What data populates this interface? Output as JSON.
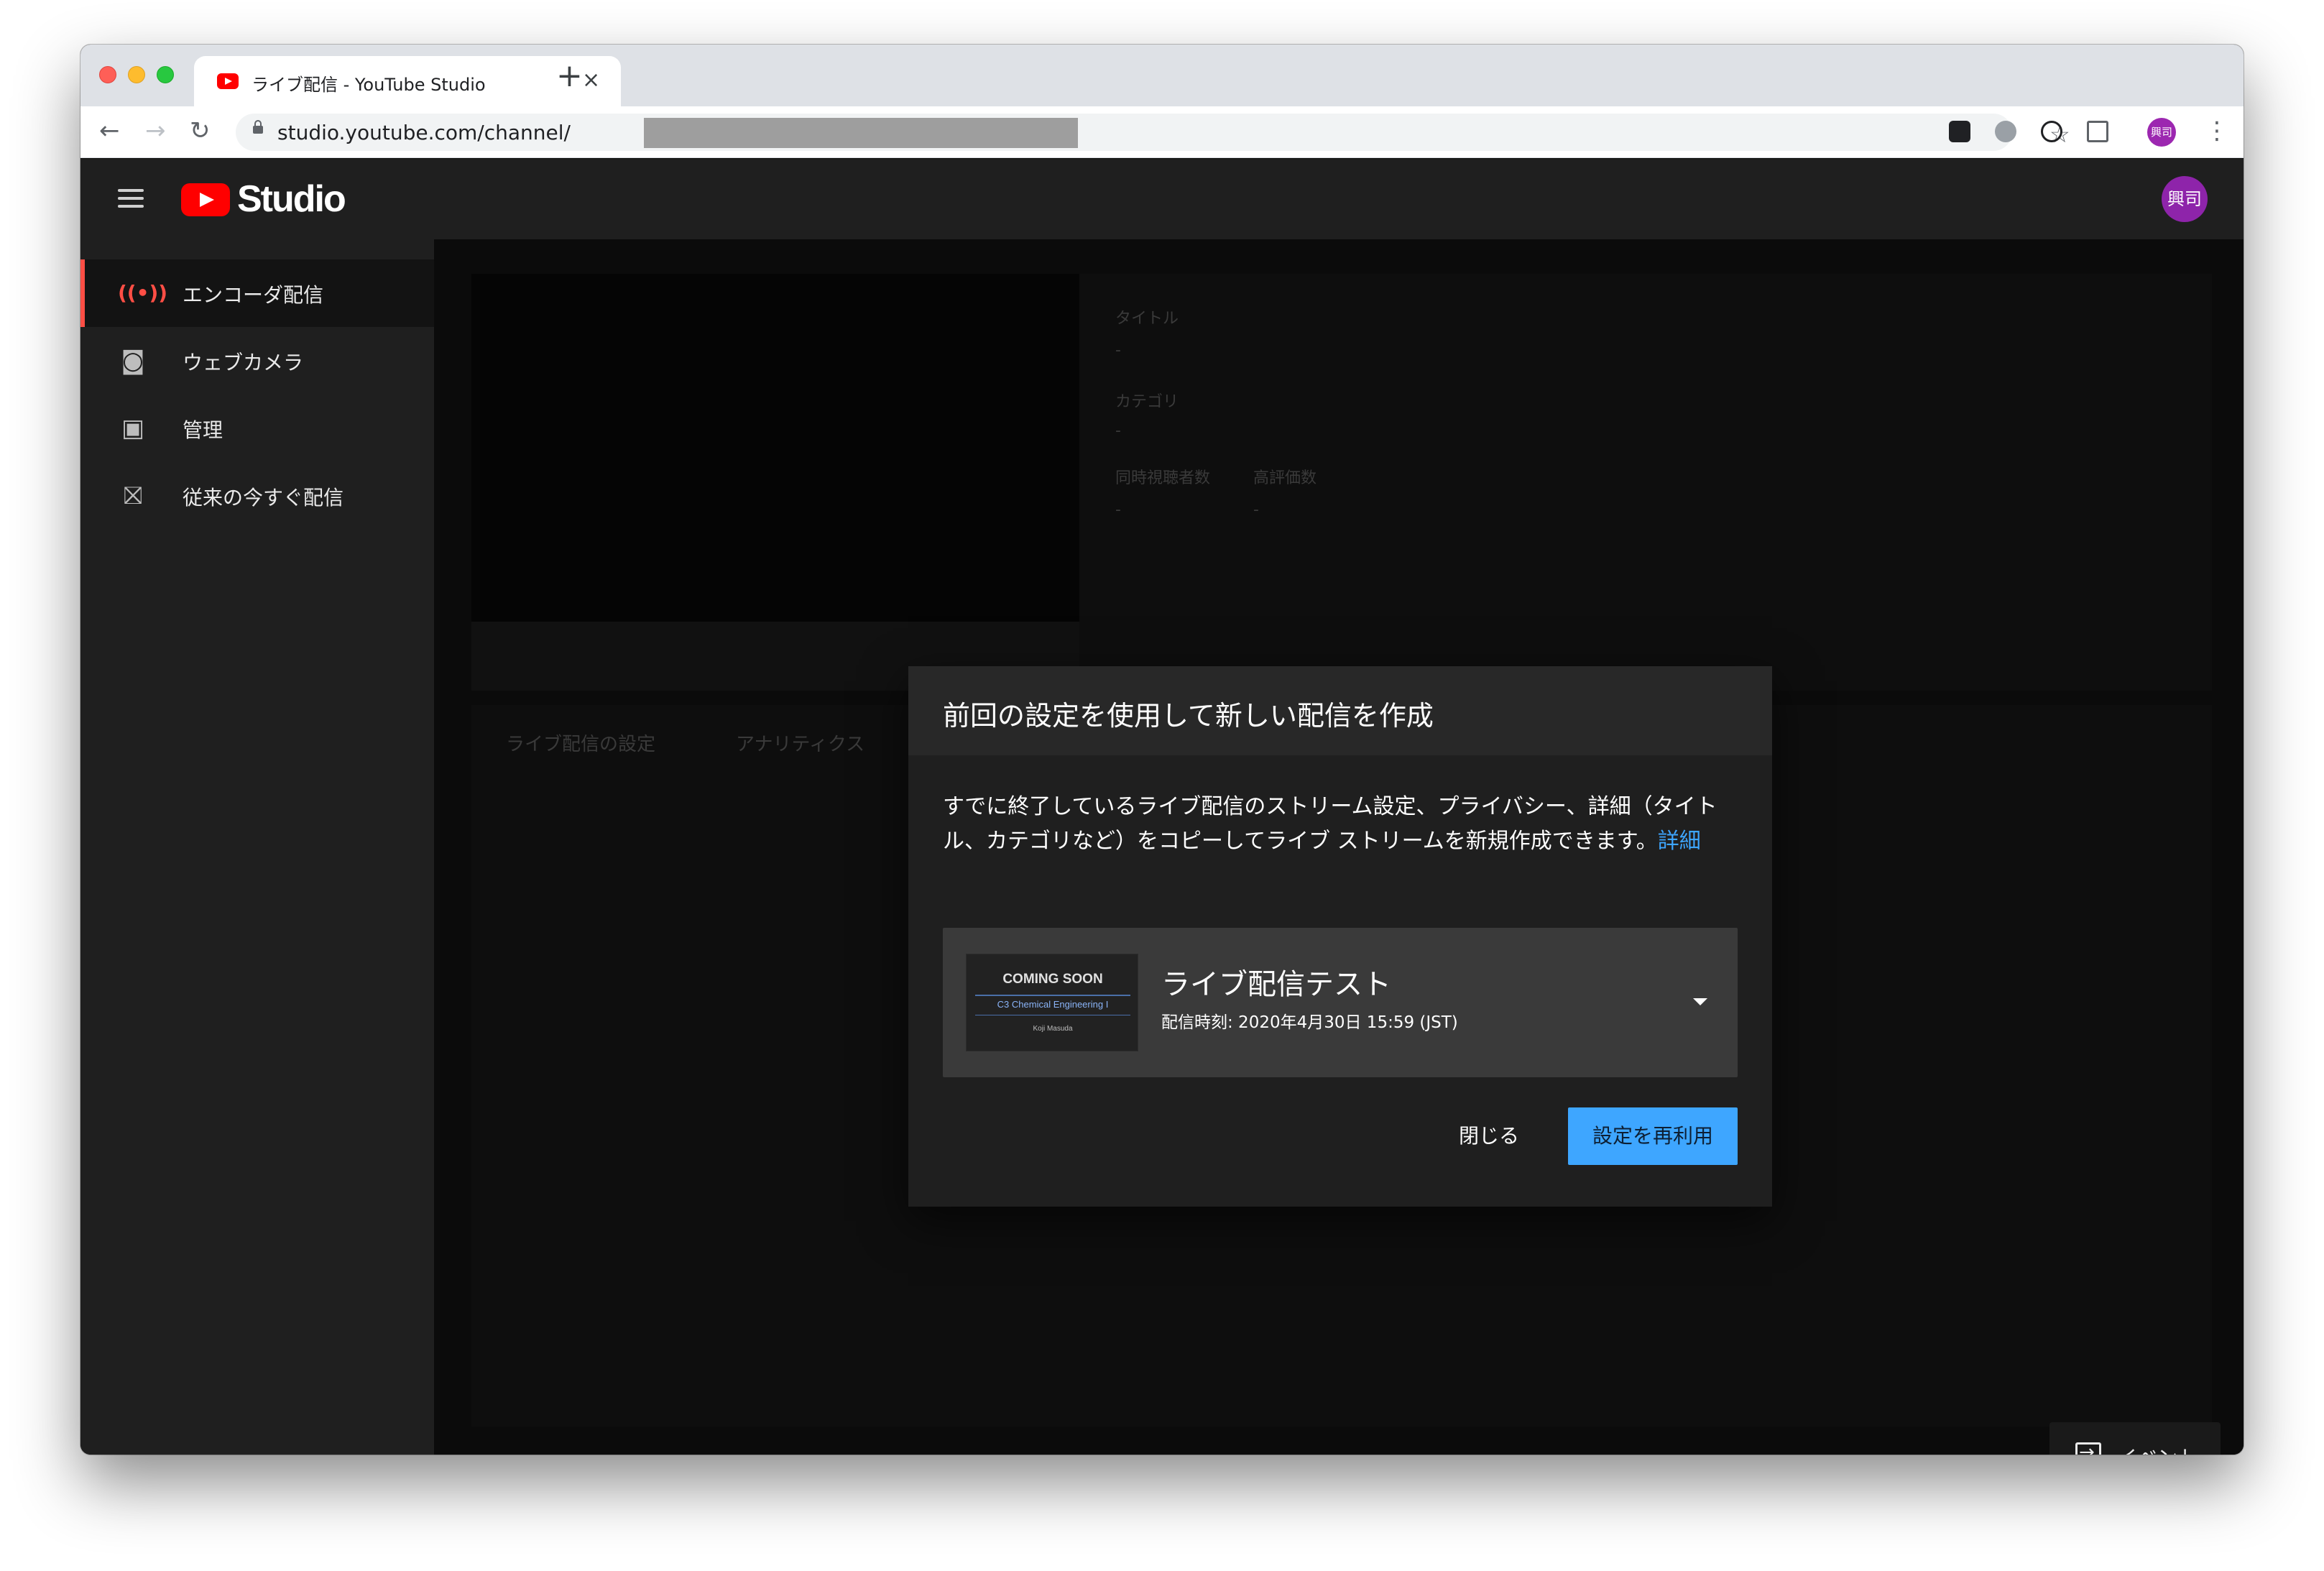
{
  "browser": {
    "tab_title": "ライブ配信 - YouTube Studio",
    "tab_close": "×",
    "new_tab": "+",
    "url": "studio.youtube.com/channel/",
    "avatar_text": "興司",
    "nav": {
      "back": "←",
      "forward": "→",
      "reload": "↻",
      "star": "☆",
      "menu": "⋮"
    }
  },
  "app": {
    "logo_text": "Studio",
    "avatar_text": "興司"
  },
  "sidebar": {
    "items": [
      {
        "label": "エンコーダ配信",
        "icon": "broadcast-icon",
        "glyph": "((•))",
        "active": true
      },
      {
        "label": "ウェブカメラ",
        "icon": "camera-icon",
        "glyph": "◙",
        "active": false
      },
      {
        "label": "管理",
        "icon": "calendar-icon",
        "glyph": "▣",
        "active": false
      },
      {
        "label": "従来の今すぐ配信",
        "icon": "classic-live-icon",
        "glyph": "⛝",
        "active": false
      }
    ]
  },
  "background": {
    "title_label": "タイトル",
    "title_value": "-",
    "category_label": "カテゴリ",
    "category_value": "-",
    "concurrent_label": "同時視聴者数",
    "concurrent_value": "-",
    "likes_label": "高評価数",
    "likes_value": "-",
    "tabs": [
      "ライブ配信の設定",
      "アナリティクス"
    ]
  },
  "event_button": {
    "label": "イベント"
  },
  "dialog": {
    "title": "前回の設定を使用して新しい配信を作成",
    "body": "すでに終了しているライブ配信のストリーム設定、プライバシー、詳細（タイトル、カテゴリなど）をコピーしてライブ ストリームを新規作成できます。",
    "link": "詳細",
    "stream": {
      "thumb_line1": "COMING SOON",
      "thumb_line2": "C3 Chemical Engineering I",
      "thumb_line3": "Koji Masuda",
      "title": "ライブ配信テスト",
      "time": "配信時刻: 2020年4月30日 15:59 (JST)"
    },
    "close_label": "閉じる",
    "reuse_label": "設定を再利用"
  }
}
